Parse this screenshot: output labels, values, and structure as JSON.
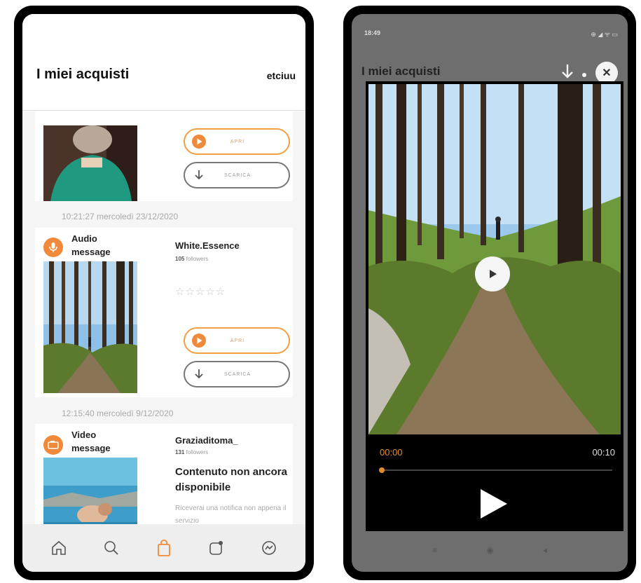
{
  "left": {
    "header": {
      "title": "I miei acquisti",
      "user": "etciuu"
    },
    "cards": [
      {
        "open_label": "APRI",
        "download_label": "SCARICA"
      },
      {
        "timestamp": "10:21:27  mercoledì 23/12/2020",
        "type_label": "Audio message",
        "seller": "White.Essence",
        "followers_count": "105",
        "followers_label": "followers",
        "rating": "☆☆☆☆☆",
        "open_label": "APRI",
        "download_label": "SCARICA"
      },
      {
        "timestamp": "12:15:40  mercoledì 9/12/2020",
        "type_label": "Video message",
        "seller": "Graziaditoma_",
        "followers_count": "131",
        "followers_label": "followers",
        "unavailable_title": "Contenuto non ancora disponibile",
        "unavailable_desc": "Riceverai una notifica non appena il servizio"
      }
    ],
    "tabbar": {
      "items": [
        "home-icon",
        "search-icon",
        "bag-icon",
        "notifications-icon",
        "chat-icon"
      ],
      "active": "bag-icon"
    }
  },
  "right": {
    "status": {
      "time": "18:49",
      "icons": "⊕ ◢ ᯤ ▭"
    },
    "header": {
      "title": "I miei acquisti",
      "close": "✕"
    },
    "player": {
      "current_time": "00:00",
      "total_time": "00:10",
      "progress": 0
    },
    "navbar": {
      "items": [
        "≡",
        "◉",
        "◂"
      ]
    }
  },
  "colors": {
    "accent": "#f08a3a",
    "player_accent": "#e58a2e"
  }
}
